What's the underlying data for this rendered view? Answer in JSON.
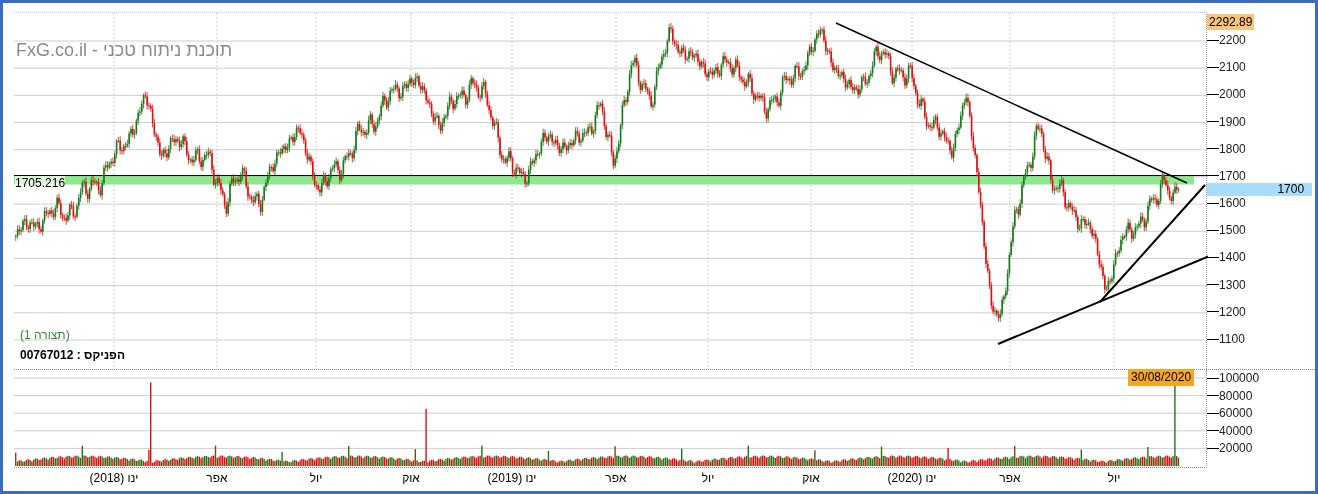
{
  "watermark": "תוכנת ניתוח טכני - FxG.co.il",
  "price_axis": {
    "last_price": "2292.89",
    "ticks": [
      "2200",
      "2100",
      "2000",
      "1900",
      "1800",
      "1700",
      "1600",
      "1500",
      "1400",
      "1300",
      "1200",
      "1100"
    ]
  },
  "level_line": {
    "value_label": "1705.216",
    "axis_label": "1700"
  },
  "pattern_label": "(תצורה 1)",
  "security": "הפניקס : 00767012",
  "volume_axis": {
    "date_label": "30/08/2020",
    "ticks": [
      "100000",
      "80000",
      "60000",
      "40000",
      "20000"
    ]
  },
  "time_axis": {
    "ticks": [
      "יול",
      "אפר",
      "ינו (2020)",
      "אוק",
      "יול",
      "אפר",
      "ינו (2019)",
      "אוק",
      "יול",
      "אפר",
      "ינו (2018)"
    ]
  }
}
